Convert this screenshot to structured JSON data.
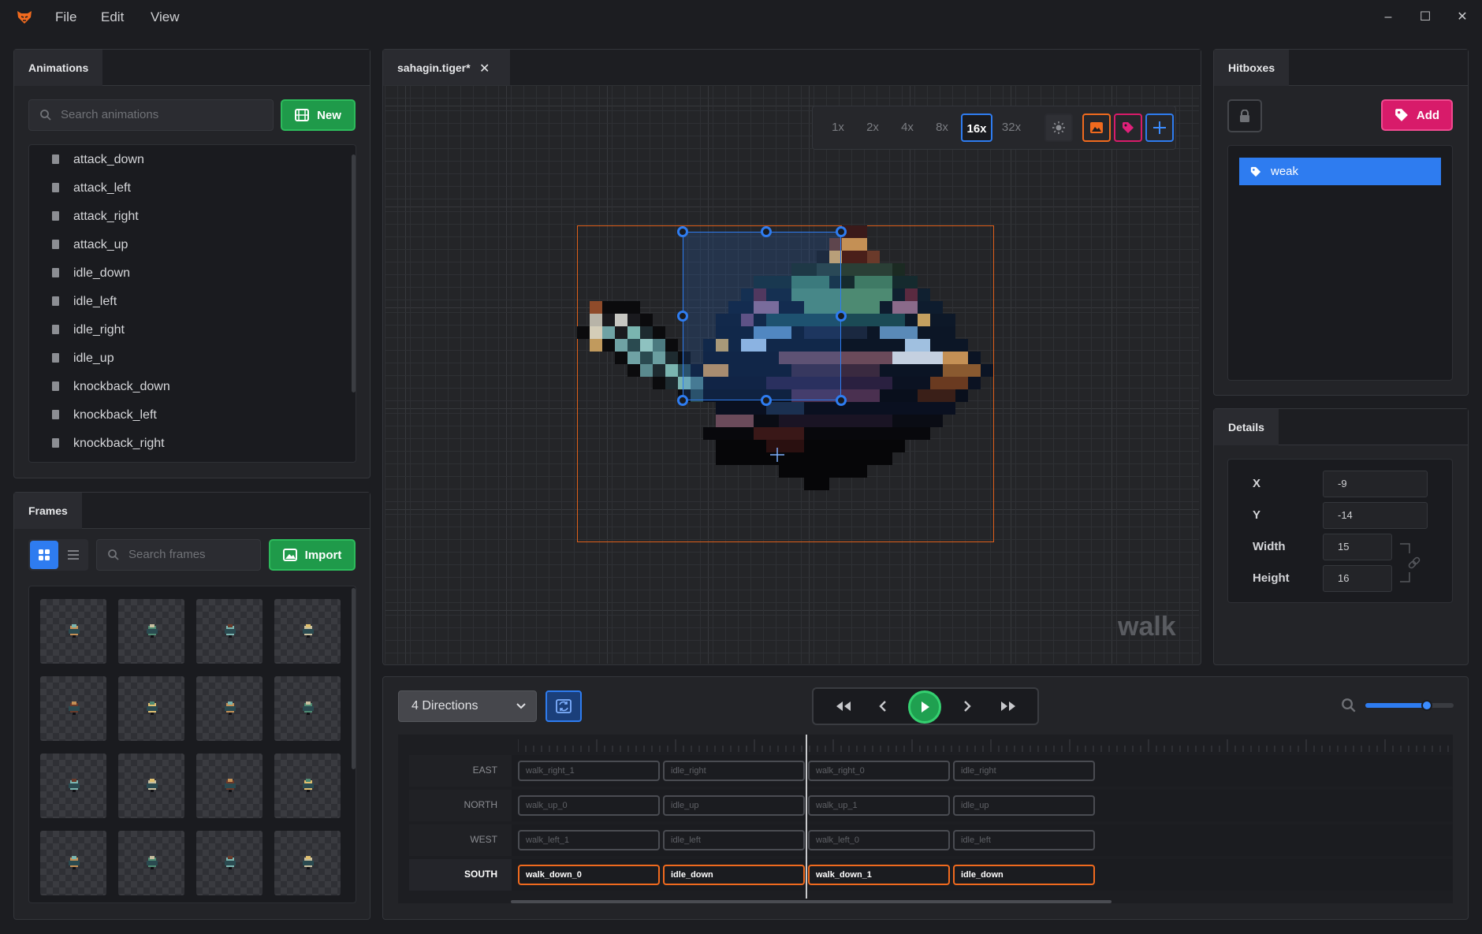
{
  "menu": {
    "file": "File",
    "edit": "Edit",
    "view": "View"
  },
  "window_controls": {
    "minimize": "–",
    "maximize": "☐",
    "close": "✕"
  },
  "animations": {
    "tab": "Animations",
    "search_placeholder": "Search animations",
    "new_label": "New",
    "items": [
      "attack_down",
      "attack_left",
      "attack_right",
      "attack_up",
      "idle_down",
      "idle_left",
      "idle_right",
      "idle_up",
      "knockback_down",
      "knockback_left",
      "knockback_right"
    ]
  },
  "frames": {
    "tab": "Frames",
    "search_placeholder": "Search frames",
    "import_label": "Import",
    "thumbnail_count": 16
  },
  "editor": {
    "tab_title": "sahagin.tiger*",
    "zoom_options": [
      "1x",
      "2x",
      "4x",
      "8x",
      "16x",
      "32x"
    ],
    "selected_zoom": "16x",
    "watermark": "walk"
  },
  "hitboxes": {
    "tab": "Hitboxes",
    "add_label": "Add",
    "items": [
      "weak"
    ]
  },
  "details": {
    "tab": "Details",
    "x_label": "X",
    "x_value": "-9",
    "y_label": "Y",
    "y_value": "-14",
    "width_label": "Width",
    "width_value": "15",
    "height_label": "Height",
    "height_value": "16"
  },
  "timeline": {
    "directions": "4 Directions",
    "zoom_level": 0.7,
    "rows": [
      {
        "label": "EAST",
        "active": false,
        "frames": [
          "walk_right_1",
          "idle_right",
          "walk_right_0",
          "idle_right"
        ]
      },
      {
        "label": "NORTH",
        "active": false,
        "frames": [
          "walk_up_0",
          "idle_up",
          "walk_up_1",
          "idle_up"
        ]
      },
      {
        "label": "WEST",
        "active": false,
        "frames": [
          "walk_left_1",
          "idle_left",
          "walk_left_0",
          "idle_left"
        ]
      },
      {
        "label": "SOUTH",
        "active": true,
        "frames": [
          "walk_down_0",
          "idle_down",
          "walk_down_1",
          "idle_down"
        ]
      }
    ]
  },
  "colors": {
    "accent_blue": "#2e7cf0",
    "accent_green": "#1f9a4a",
    "accent_pink": "#d81b6a",
    "accent_orange": "#f06a1e"
  }
}
